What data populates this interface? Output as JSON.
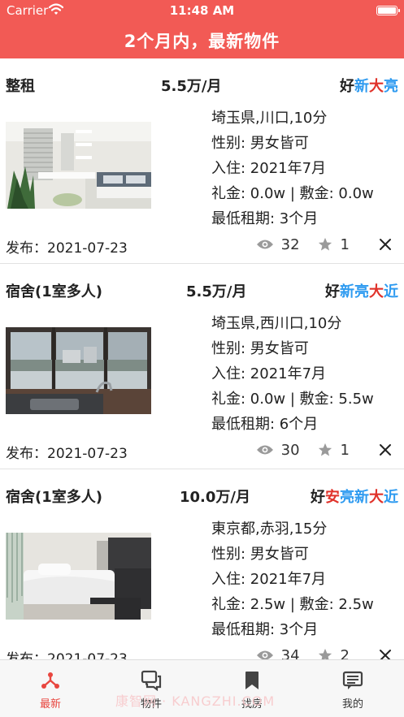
{
  "status_bar": {
    "carrier": "Carrier",
    "time": "11:48 AM"
  },
  "nav": {
    "title": "2个月内，最新物件"
  },
  "listings": [
    {
      "type": "整租",
      "price": "5.5万/月",
      "tags": [
        {
          "text": "好",
          "color": "#222222"
        },
        {
          "text": "新",
          "color": "#2f9bf0"
        },
        {
          "text": "大",
          "color": "#e0322a"
        },
        {
          "text": "亮",
          "color": "#2f9bf0"
        }
      ],
      "location": "埼玉県,川口,10分",
      "gender": "性别: 男女皆可",
      "move_in": "入住: 2021年7月",
      "fees": "礼金: 0.0w | 敷金: 0.0w",
      "min_term": "最低租期: 3个月",
      "posted": "发布：2021-07-23",
      "views": "32",
      "favorites": "1",
      "photo": "bright-room-photo"
    },
    {
      "type": "宿舍(1室多人)",
      "price": "5.5万/月",
      "tags": [
        {
          "text": "好",
          "color": "#222222"
        },
        {
          "text": "新",
          "color": "#2f9bf0"
        },
        {
          "text": "亮",
          "color": "#2f9bf0"
        },
        {
          "text": "大",
          "color": "#e0322a"
        },
        {
          "text": "近",
          "color": "#2f9bf0"
        }
      ],
      "location": "埼玉県,西川口,10分",
      "gender": "性别: 男女皆可",
      "move_in": "入住: 2021年7月",
      "fees": "礼金: 0.0w | 敷金: 5.5w",
      "min_term": "最低租期: 6个月",
      "posted": "发布：2021-07-23",
      "views": "30",
      "favorites": "1",
      "photo": "balcony-view-photo"
    },
    {
      "type": "宿舍(1室多人)",
      "price": "10.0万/月",
      "tags": [
        {
          "text": "好",
          "color": "#222222"
        },
        {
          "text": "安",
          "color": "#e0322a"
        },
        {
          "text": "亮",
          "color": "#2f9bf0"
        },
        {
          "text": "新",
          "color": "#2f9bf0"
        },
        {
          "text": "大",
          "color": "#e0322a"
        },
        {
          "text": "近",
          "color": "#2f9bf0"
        }
      ],
      "location": "東京都,赤羽,15分",
      "gender": "性别: 男女皆可",
      "move_in": "入住: 2021年7月",
      "fees": "礼金: 2.5w | 敷金: 2.5w",
      "min_term": "最低租期: 3个月",
      "posted": "发布：2021-07-23",
      "views": "34",
      "favorites": "2",
      "photo": "bedroom-photo"
    }
  ],
  "tabbar": {
    "items": [
      {
        "label": "最新",
        "icon": "latest-icon",
        "active": true
      },
      {
        "label": "物件",
        "icon": "listings-icon",
        "active": false
      },
      {
        "label": "找房",
        "icon": "bookmark-icon",
        "active": false
      },
      {
        "label": "我的",
        "icon": "messages-icon",
        "active": false
      }
    ]
  },
  "watermark": "康智网 · KANGZHI.COM",
  "colors": {
    "accent": "#f25a55",
    "tab_active": "#e8463f",
    "tag_blue": "#2f9bf0",
    "tag_red": "#e0322a"
  }
}
